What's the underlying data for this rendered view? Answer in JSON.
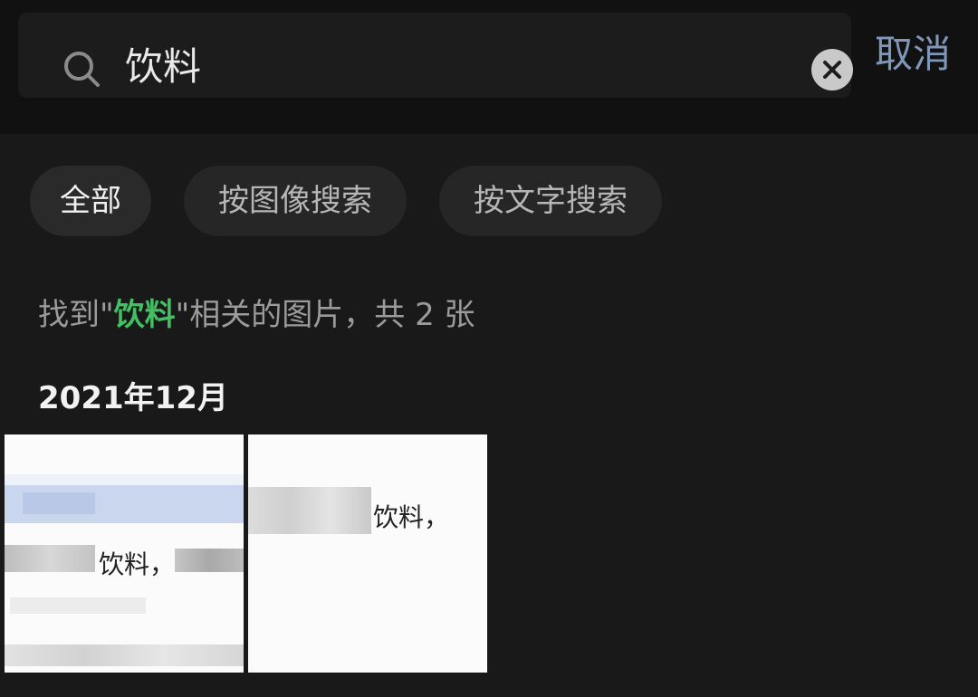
{
  "search": {
    "query": "饮料",
    "cancel_label": "取消"
  },
  "filters": [
    {
      "label": "全部",
      "active": true
    },
    {
      "label": "按图像搜索",
      "active": false
    },
    {
      "label": "按文字搜索",
      "active": false
    }
  ],
  "result": {
    "prefix": "找到\"",
    "keyword": "饮料",
    "suffix": "\"相关的图片，共 2 张"
  },
  "group": {
    "month": "2021年12月"
  },
  "thumbnails": [
    {
      "text": "饮料，"
    },
    {
      "text": "饮料，"
    }
  ],
  "colors": {
    "background": "#191919",
    "header": "#111111",
    "accent_keyword": "#43c063",
    "cancel": "#7f98b9"
  },
  "icons": {
    "search": "search-icon",
    "clear": "clear-icon"
  }
}
